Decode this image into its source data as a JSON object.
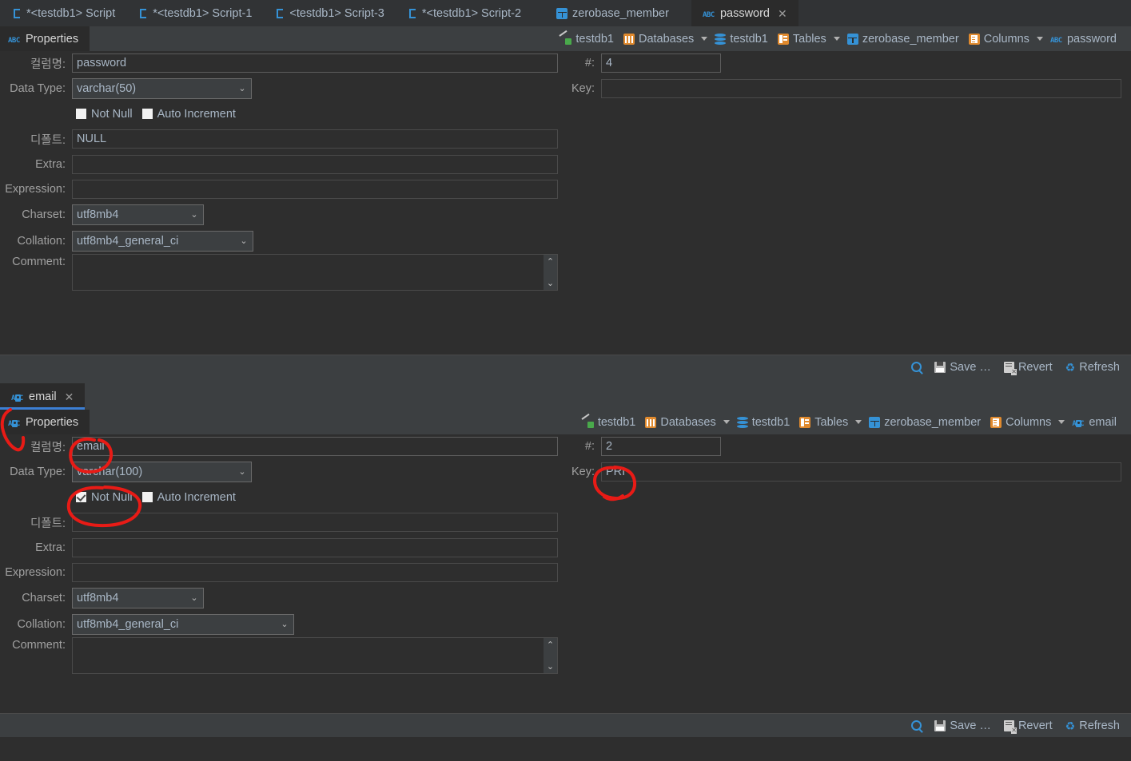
{
  "editor_tabs": [
    {
      "label": "*<testdb1> Script",
      "icon": "script-icon",
      "active": false,
      "closable": false
    },
    {
      "label": "*<testdb1> Script-1",
      "icon": "script-icon",
      "active": false,
      "closable": false
    },
    {
      "label": "<testdb1> Script-3",
      "icon": "script-icon",
      "active": false,
      "closable": false
    },
    {
      "label": "*<testdb1> Script-2",
      "icon": "script-icon",
      "active": false,
      "closable": false
    },
    {
      "label": "zerobase_member",
      "icon": "table-icon",
      "active": false,
      "closable": false
    },
    {
      "label": "password",
      "icon": "abc-icon",
      "active": true,
      "closable": true
    }
  ],
  "panel_top": {
    "properties_tab": {
      "label": "Properties",
      "icon": "abc-icon"
    },
    "breadcrumb": [
      {
        "label": "testdb1",
        "icon": "connection-icon",
        "caret": false
      },
      {
        "label": "Databases",
        "icon": "databases-icon",
        "caret": true
      },
      {
        "label": "testdb1",
        "icon": "database-icon",
        "caret": false
      },
      {
        "label": "Tables",
        "icon": "tables-icon",
        "caret": true
      },
      {
        "label": "zerobase_member",
        "icon": "table-icon",
        "caret": false
      },
      {
        "label": "Columns",
        "icon": "columns-icon",
        "caret": true
      },
      {
        "label": "password",
        "icon": "abc-icon",
        "caret": false
      }
    ],
    "fields": {
      "column_name_label": "컬럼명:",
      "column_name_value": "password",
      "data_type_label": "Data Type:",
      "data_type_value": "varchar(50)",
      "not_null_label": "Not Null",
      "not_null_checked": false,
      "auto_increment_label": "Auto Increment",
      "auto_increment_checked": false,
      "default_label": "디폴트:",
      "default_value": "NULL",
      "extra_label": "Extra:",
      "extra_value": "",
      "expression_label": "Expression:",
      "expression_value": "",
      "charset_label": "Charset:",
      "charset_value": "utf8mb4",
      "collation_label": "Collation:",
      "collation_value": "utf8mb4_general_ci",
      "comment_label": "Comment:",
      "comment_value": "",
      "num_label": "#:",
      "num_value": "4",
      "key_label": "Key:",
      "key_value": ""
    },
    "footer": {
      "search_icon": "search-icon",
      "save_label": "Save …",
      "revert_label": "Revert",
      "refresh_label": "Refresh"
    }
  },
  "panel_bottom": {
    "tab": {
      "label": "email",
      "icon": "abc-key-icon",
      "active": true,
      "closable": true
    },
    "properties_tab": {
      "label": "Properties",
      "icon": "abc-key-icon"
    },
    "breadcrumb": [
      {
        "label": "testdb1",
        "icon": "connection-icon",
        "caret": false
      },
      {
        "label": "Databases",
        "icon": "databases-icon",
        "caret": true
      },
      {
        "label": "testdb1",
        "icon": "database-icon",
        "caret": false
      },
      {
        "label": "Tables",
        "icon": "tables-icon",
        "caret": true
      },
      {
        "label": "zerobase_member",
        "icon": "table-icon",
        "caret": false
      },
      {
        "label": "Columns",
        "icon": "columns-icon",
        "caret": true
      },
      {
        "label": "email",
        "icon": "abc-key-icon",
        "caret": false
      }
    ],
    "fields": {
      "column_name_label": "컬럼명:",
      "column_name_value": "email",
      "data_type_label": "Data Type:",
      "data_type_value": "varchar(100)",
      "not_null_label": "Not Null",
      "not_null_checked": true,
      "auto_increment_label": "Auto Increment",
      "auto_increment_checked": false,
      "default_label": "디폴트:",
      "default_value": "",
      "extra_label": "Extra:",
      "extra_value": "",
      "expression_label": "Expression:",
      "expression_value": "",
      "charset_label": "Charset:",
      "charset_value": "utf8mb4",
      "collation_label": "Collation:",
      "collation_value": "utf8mb4_general_ci",
      "comment_label": "Comment:",
      "comment_value": "",
      "num_label": "#:",
      "num_value": "2",
      "key_label": "Key:",
      "key_value": "PRI"
    },
    "footer": {
      "search_icon": "search-icon",
      "save_label": "Save …",
      "revert_label": "Revert",
      "refresh_label": "Refresh"
    }
  },
  "annotations": {
    "color": "#e81b16",
    "shapes": [
      {
        "name": "circle-properties-icon"
      },
      {
        "name": "circle-column-name-value"
      },
      {
        "name": "circle-not-null-checkbox"
      },
      {
        "name": "circle-key-value"
      }
    ]
  },
  "theme": {
    "background": "#2e2e2e",
    "toolbar": "#3c3f41",
    "active_tab": "#2b2b2b",
    "text": "#a9b7c6",
    "accent": "#3592d6"
  }
}
